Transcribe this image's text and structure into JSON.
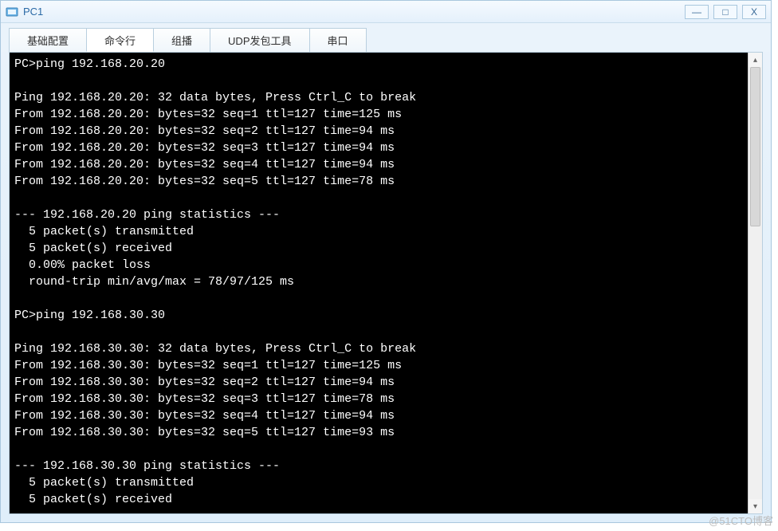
{
  "window": {
    "title": "PC1",
    "controls": {
      "min": "—",
      "max": "□",
      "close": "X"
    }
  },
  "tabs": [
    {
      "label": "基础配置",
      "active": false
    },
    {
      "label": "命令行",
      "active": true
    },
    {
      "label": "组播",
      "active": false
    },
    {
      "label": "UDP发包工具",
      "active": false
    },
    {
      "label": "串口",
      "active": false
    }
  ],
  "terminal": {
    "lines": [
      "PC>ping 192.168.20.20",
      "",
      "Ping 192.168.20.20: 32 data bytes, Press Ctrl_C to break",
      "From 192.168.20.20: bytes=32 seq=1 ttl=127 time=125 ms",
      "From 192.168.20.20: bytes=32 seq=2 ttl=127 time=94 ms",
      "From 192.168.20.20: bytes=32 seq=3 ttl=127 time=94 ms",
      "From 192.168.20.20: bytes=32 seq=4 ttl=127 time=94 ms",
      "From 192.168.20.20: bytes=32 seq=5 ttl=127 time=78 ms",
      "",
      "--- 192.168.20.20 ping statistics ---",
      "  5 packet(s) transmitted",
      "  5 packet(s) received",
      "  0.00% packet loss",
      "  round-trip min/avg/max = 78/97/125 ms",
      "",
      "PC>ping 192.168.30.30",
      "",
      "Ping 192.168.30.30: 32 data bytes, Press Ctrl_C to break",
      "From 192.168.30.30: bytes=32 seq=1 ttl=127 time=125 ms",
      "From 192.168.30.30: bytes=32 seq=2 ttl=127 time=94 ms",
      "From 192.168.30.30: bytes=32 seq=3 ttl=127 time=78 ms",
      "From 192.168.30.30: bytes=32 seq=4 ttl=127 time=94 ms",
      "From 192.168.30.30: bytes=32 seq=5 ttl=127 time=93 ms",
      "",
      "--- 192.168.30.30 ping statistics ---",
      "  5 packet(s) transmitted",
      "  5 packet(s) received"
    ]
  },
  "scrollbar": {
    "up": "▴",
    "down": "▾"
  },
  "watermark": "@51CTO博客"
}
